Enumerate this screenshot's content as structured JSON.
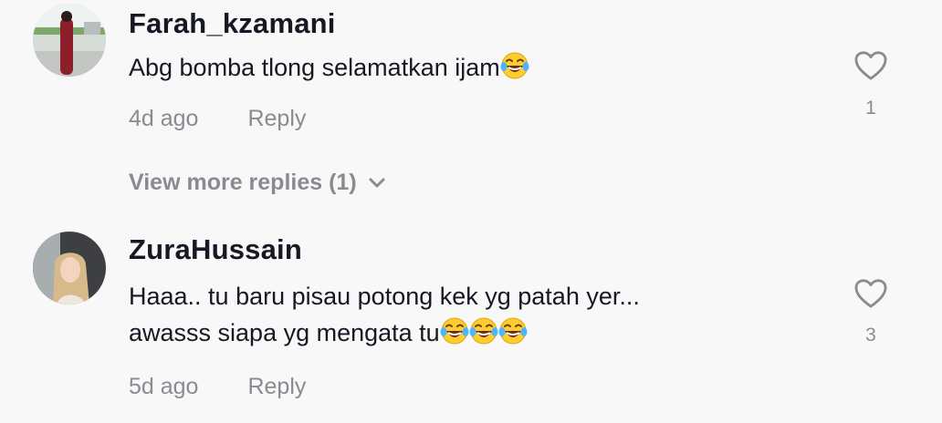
{
  "comments": [
    {
      "username": "Farah_kzamani",
      "text_before_emoji": "Abg bomba tlong selamatkan ijam",
      "emojis": [
        "face-with-tears-of-joy"
      ],
      "time": "4d ago",
      "reply_label": "Reply",
      "likes": "1",
      "view_more": "View more replies (1)"
    },
    {
      "username": "ZuraHussain",
      "line1": "Haaa.. tu baru pisau potong kek yg patah yer...",
      "line2": "awasss siapa yg mengata tu",
      "emojis": [
        "face-with-tears-of-joy",
        "face-with-tears-of-joy",
        "face-with-tears-of-joy"
      ],
      "time": "5d ago",
      "reply_label": "Reply",
      "likes": "3"
    }
  ],
  "colors": {
    "background": "#f8f8f8",
    "primary_text": "#161823",
    "secondary_text": "#8a8b91"
  },
  "icons": [
    "heart-outline-icon",
    "chevron-down-icon",
    "face-with-tears-of-joy-emoji"
  ]
}
